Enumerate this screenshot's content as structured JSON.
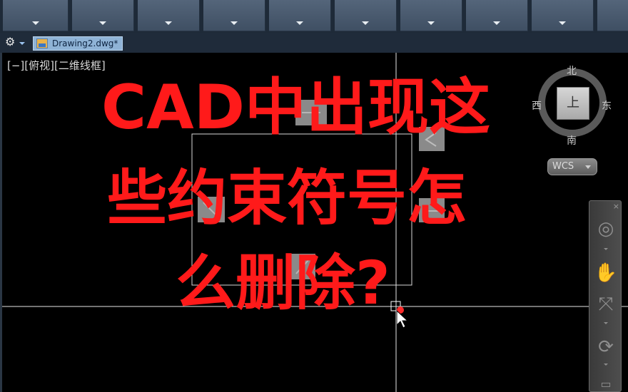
{
  "ribbon": {
    "panels": [
      {
        "id": 1
      },
      {
        "id": 2
      },
      {
        "id": 3
      },
      {
        "id": 4
      },
      {
        "id": 5
      },
      {
        "id": 6
      },
      {
        "id": 7
      },
      {
        "id": 8
      },
      {
        "id": 9
      }
    ]
  },
  "toolbar": {
    "gear_icon": "gear-icon",
    "file_tab_label": "Drawing2.dwg*"
  },
  "viewport": {
    "label": "[−][俯视][二维线框]"
  },
  "overlay_text": {
    "line1": "CAD中出现这",
    "line2": "些约束符号怎",
    "line3": "么删除?"
  },
  "viewcube": {
    "north": "北",
    "south": "南",
    "east": "东",
    "west": "西",
    "face": "上",
    "wcs_label": "WCS"
  },
  "navbar": {
    "close_label": "×",
    "buttons": [
      "steering-wheel-icon",
      "pan-icon",
      "zoom-icon",
      "orbit-icon",
      "showmotion-icon"
    ]
  },
  "colors": {
    "overlay_red": "#ff1a1a",
    "crosshair": "#e6e6e6",
    "constraint_marker": "#8a8a8a",
    "cursor_dot": "#ff2a2a"
  }
}
